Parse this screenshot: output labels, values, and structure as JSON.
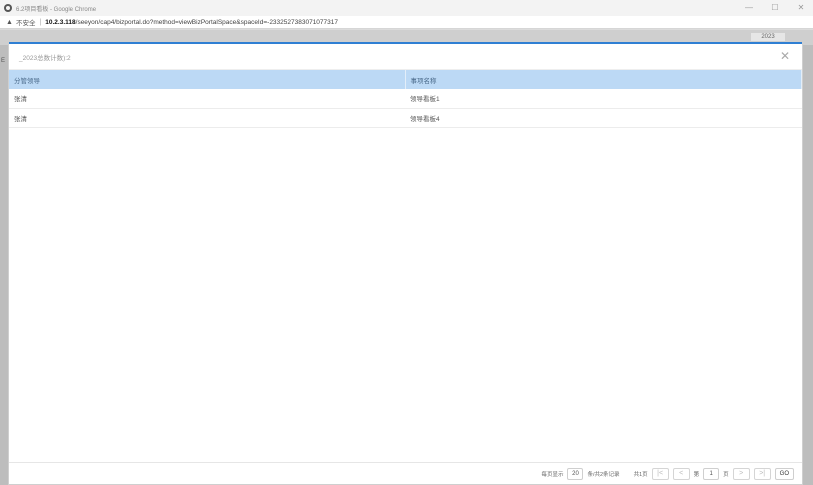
{
  "window": {
    "title": "6.2项目看板 - Google Chrome",
    "controls": {
      "minimize": "—",
      "maximize": "☐",
      "close": "✕"
    }
  },
  "addressbar": {
    "insecure_label": "不安全",
    "url_host": "10.2.3.118",
    "url_path": "/seeyon/cap4/bizportal.do?method=viewBizPortalSpace&spaceId=-2332527383071077317"
  },
  "background": {
    "year_chip": "2023",
    "side_mark": "E"
  },
  "modal": {
    "title": "_2023总数计数):2",
    "table": {
      "headers": [
        "分管领导",
        "事项名称"
      ],
      "rows": [
        [
          "张清",
          "领导看板1"
        ],
        [
          "张清",
          "领导看板4"
        ]
      ]
    },
    "pager": {
      "per_page_label": "每页显示",
      "per_page_value": "20",
      "total_label": "条/共2条记录",
      "pages_label": "共1页",
      "first": "|<",
      "prev": "<",
      "page_prefix": "第",
      "current_page": "1",
      "page_suffix": "页",
      "next": ">",
      "last": ">|",
      "go_label": "GO"
    }
  }
}
